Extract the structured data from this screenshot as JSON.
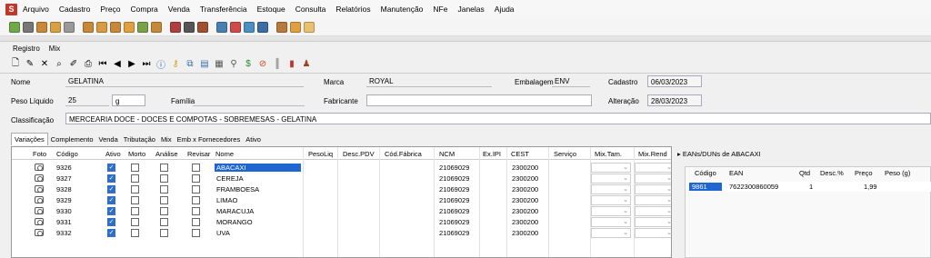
{
  "menu": [
    "Arquivo",
    "Cadastro",
    "Preço",
    "Compra",
    "Venda",
    "Transferência",
    "Estoque",
    "Consulta",
    "Relatórios",
    "Manutenção",
    "NFe",
    "Janelas",
    "Ajuda"
  ],
  "submenu": [
    "Registro",
    "Mix"
  ],
  "form": {
    "nome_label": "Nome",
    "nome": "GELATINA",
    "marca_label": "Marca",
    "marca": "ROYAL",
    "embalagem_label": "Embalagem",
    "embalagem": "ENV",
    "cadastro_label": "Cadastro",
    "cadastro": "06/03/2023",
    "peso_label": "Peso Líquido",
    "peso": "25",
    "unidade": "g",
    "familia_label": "Família",
    "fabricante_label": "Fabricante",
    "alteracao_label": "Alteração",
    "alteracao": "28/03/2023",
    "classificacao_label": "Classificação",
    "classificacao": "MERCEARIA DOCE - DOCES E COMPOTAS - SOBREMESAS - GELATINA"
  },
  "tabs": [
    "Variações",
    "Complemento",
    "Venda",
    "Tributação",
    "Mix",
    "Emb x Fornecedores",
    "Ativo"
  ],
  "grid": {
    "headers": [
      "Foto",
      "Código",
      "Ativo",
      "Morto",
      "Análise",
      "Revisar",
      "Nome",
      "PesoLiq",
      "Desc.PDV",
      "Cód.Fábrica",
      "NCM",
      "Ex.IPI",
      "CEST",
      "Serviço",
      "Mix.Tam.",
      "Mix.Rend"
    ],
    "rows": [
      {
        "codigo": "9326",
        "nome": "ABACAXI",
        "ncm": "21069029",
        "cest": "2300200"
      },
      {
        "codigo": "9327",
        "nome": "CEREJA",
        "ncm": "21069029",
        "cest": "2300200"
      },
      {
        "codigo": "9328",
        "nome": "FRAMBOESA",
        "ncm": "21069029",
        "cest": "2300200"
      },
      {
        "codigo": "9329",
        "nome": "LIMAO",
        "ncm": "21069029",
        "cest": "2300200"
      },
      {
        "codigo": "9330",
        "nome": "MARACUJA",
        "ncm": "21069029",
        "cest": "2300200"
      },
      {
        "codigo": "9331",
        "nome": "MORANGO",
        "ncm": "21069029",
        "cest": "2300200"
      },
      {
        "codigo": "9332",
        "nome": "UVA",
        "ncm": "21069029",
        "cest": "2300200"
      }
    ]
  },
  "ean": {
    "title": "EANs/DUNs de ABACAXI",
    "headers": [
      "Código",
      "EAN",
      "Qtd",
      "Desc.%",
      "Preço",
      "Peso (g)"
    ],
    "row": {
      "codigo": "9861",
      "ean": "7622300860059",
      "qtd": "1",
      "preco": "1,99"
    }
  }
}
